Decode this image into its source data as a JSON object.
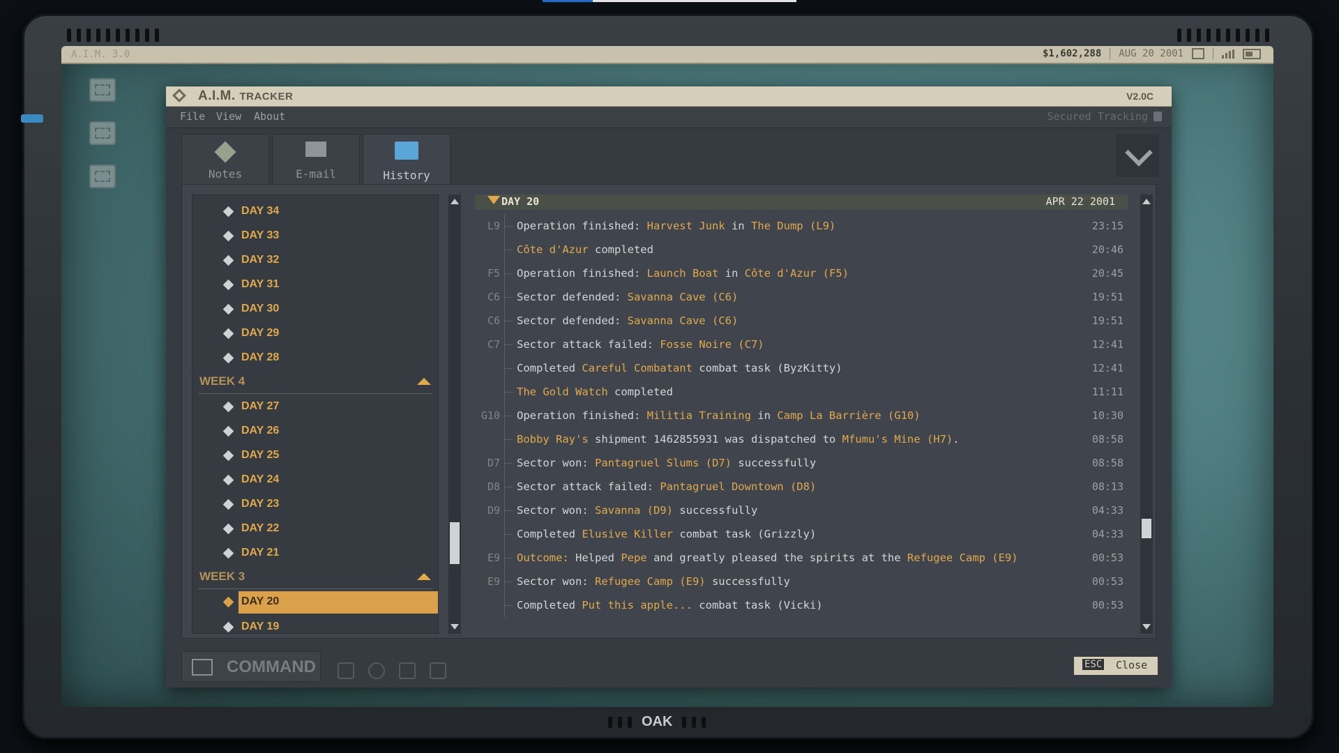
{
  "os": {
    "title": "A.I.M. 3.0",
    "money": "$1,602,288",
    "date": "AUG 20 2001",
    "brand": "OAK"
  },
  "window": {
    "title_main": "A.I.M.",
    "title_sub": "TRACKER",
    "version": "V2.0C",
    "menu": [
      "File",
      "View",
      "About"
    ],
    "secured": "Secured Tracking"
  },
  "tabs": [
    {
      "label": "Notes",
      "icon": "notes-icon"
    },
    {
      "label": "E-mail",
      "icon": "mail-icon"
    },
    {
      "label": "History",
      "icon": "folder-icon"
    }
  ],
  "history": {
    "week5_days": [
      "DAY 34",
      "DAY 33",
      "DAY 32",
      "DAY 31",
      "DAY 30",
      "DAY 29",
      "DAY 28"
    ],
    "week4_label": "WEEK 4",
    "week4_days": [
      "DAY 27",
      "DAY 26",
      "DAY 25",
      "DAY 24",
      "DAY 23",
      "DAY 22",
      "DAY 21"
    ],
    "week3_label": "WEEK 3",
    "selected_day": "DAY 20",
    "next_day": "DAY 19"
  },
  "log": {
    "day": "DAY 20",
    "date": "APR 22 2001",
    "entries": [
      {
        "sector": "L9",
        "time": "23:15",
        "parts": [
          [
            "Operation finished: ",
            0
          ],
          [
            "Harvest Junk",
            1
          ],
          [
            " in ",
            0
          ],
          [
            "The Dump (L9)",
            1
          ]
        ]
      },
      {
        "sector": "",
        "time": "20:46",
        "parts": [
          [
            "Côte d'Azur",
            1
          ],
          [
            " completed",
            0
          ]
        ]
      },
      {
        "sector": "F5",
        "time": "20:45",
        "parts": [
          [
            "Operation finished: ",
            0
          ],
          [
            "Launch Boat",
            1
          ],
          [
            " in ",
            0
          ],
          [
            "Côte d'Azur (F5)",
            1
          ]
        ]
      },
      {
        "sector": "C6",
        "time": "19:51",
        "parts": [
          [
            "Sector defended: ",
            0
          ],
          [
            "Savanna Cave (C6)",
            1
          ]
        ]
      },
      {
        "sector": "C6",
        "time": "19:51",
        "parts": [
          [
            "Sector defended: ",
            0
          ],
          [
            "Savanna Cave (C6)",
            1
          ]
        ]
      },
      {
        "sector": "C7",
        "time": "12:41",
        "parts": [
          [
            "Sector attack failed: ",
            0
          ],
          [
            "Fosse Noire (C7)",
            1
          ]
        ]
      },
      {
        "sector": "",
        "time": "12:41",
        "parts": [
          [
            "Completed ",
            0
          ],
          [
            "Careful Combatant",
            1
          ],
          [
            " combat task (ByzKitty)",
            0
          ]
        ]
      },
      {
        "sector": "",
        "time": "11:11",
        "parts": [
          [
            "The Gold Watch",
            1
          ],
          [
            " completed",
            0
          ]
        ]
      },
      {
        "sector": "G10",
        "time": "10:30",
        "parts": [
          [
            "Operation finished: ",
            0
          ],
          [
            "Militia Training",
            1
          ],
          [
            " in ",
            0
          ],
          [
            "Camp La Barrière (G10)",
            1
          ]
        ]
      },
      {
        "sector": "",
        "time": "08:58",
        "parts": [
          [
            "Bobby Ray's",
            1
          ],
          [
            " shipment 1462855931 was dispatched to ",
            0
          ],
          [
            "Mfumu's Mine (H7)",
            1
          ],
          [
            ".",
            0
          ]
        ]
      },
      {
        "sector": "D7",
        "time": "08:58",
        "parts": [
          [
            "Sector won: ",
            0
          ],
          [
            "Pantagruel Slums (D7)",
            1
          ],
          [
            " successfully",
            0
          ]
        ]
      },
      {
        "sector": "D8",
        "time": "08:13",
        "parts": [
          [
            "Sector attack failed: ",
            0
          ],
          [
            "Pantagruel Downtown (D8)",
            1
          ]
        ]
      },
      {
        "sector": "D9",
        "time": "04:33",
        "parts": [
          [
            "Sector won: ",
            0
          ],
          [
            "Savanna (D9)",
            1
          ],
          [
            " successfully",
            0
          ]
        ]
      },
      {
        "sector": "",
        "time": "04:33",
        "parts": [
          [
            "Completed ",
            0
          ],
          [
            "Elusive Killer",
            1
          ],
          [
            " combat task (Grizzly)",
            0
          ]
        ]
      },
      {
        "sector": "E9",
        "time": "00:53",
        "parts": [
          [
            "Outcome:",
            1
          ],
          [
            " Helped ",
            0
          ],
          [
            "Pepe",
            1
          ],
          [
            " and greatly pleased the spirits at the ",
            0
          ],
          [
            "Refugee Camp (E9)",
            1
          ]
        ]
      },
      {
        "sector": "E9",
        "time": "00:53",
        "parts": [
          [
            "Sector won: ",
            0
          ],
          [
            "Refugee Camp (E9)",
            1
          ],
          [
            " successfully",
            0
          ]
        ]
      },
      {
        "sector": "",
        "time": "00:53",
        "parts": [
          [
            "Completed ",
            0
          ],
          [
            "Put this apple...",
            1
          ],
          [
            " combat task (Vicki)",
            0
          ]
        ]
      }
    ]
  },
  "bottom": {
    "command": "COMMAND",
    "esc_key": "ESC",
    "close": "Close"
  }
}
